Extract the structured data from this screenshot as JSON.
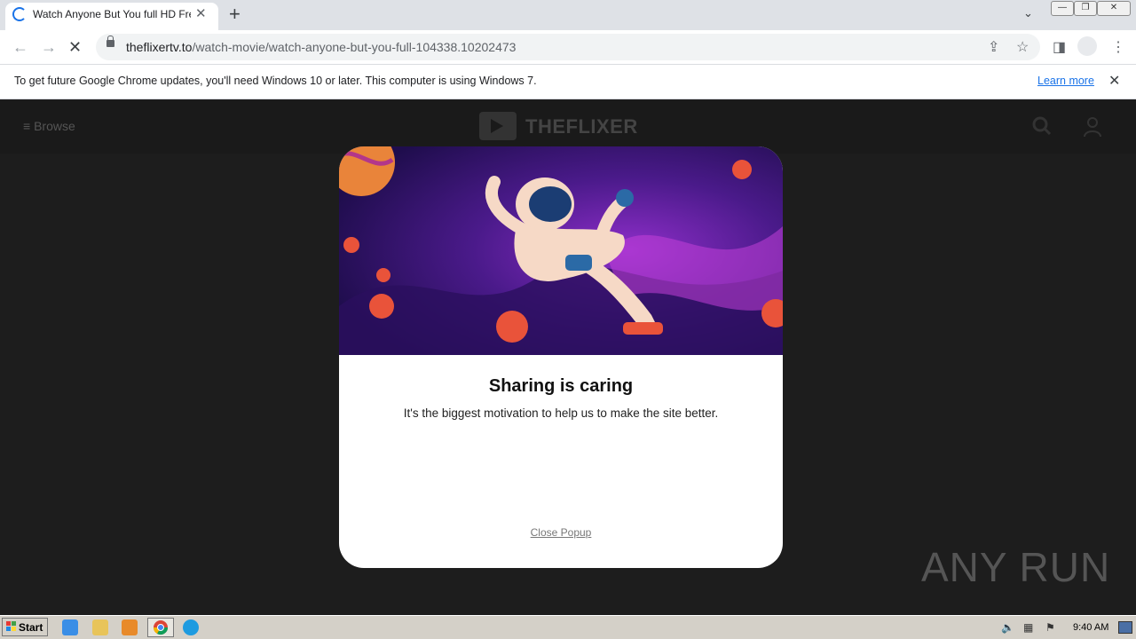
{
  "browser": {
    "tab_title": "Watch Anyone But You full HD Free",
    "url_domain": "theflixertv.to",
    "url_path": "/watch-movie/watch-anyone-but-you-full-104338.10202473"
  },
  "infobar": {
    "message": "To get future Google Chrome updates, you'll need Windows 10 or later. This computer is using Windows 7.",
    "learn_more": "Learn more"
  },
  "site": {
    "browse_label": "Browse",
    "logo_text": "THEFLIXER"
  },
  "popup": {
    "title": "Sharing is caring",
    "subtitle": "It's the biggest motivation to help us to make the site better.",
    "close_label": "Close Popup"
  },
  "watermark": "ANY RUN",
  "taskbar": {
    "start_label": "Start",
    "clock": "9:40 AM"
  },
  "colors": {
    "accent": "#1a73e8",
    "space_purple": "#3a1670",
    "planet_red": "#e9533a"
  }
}
